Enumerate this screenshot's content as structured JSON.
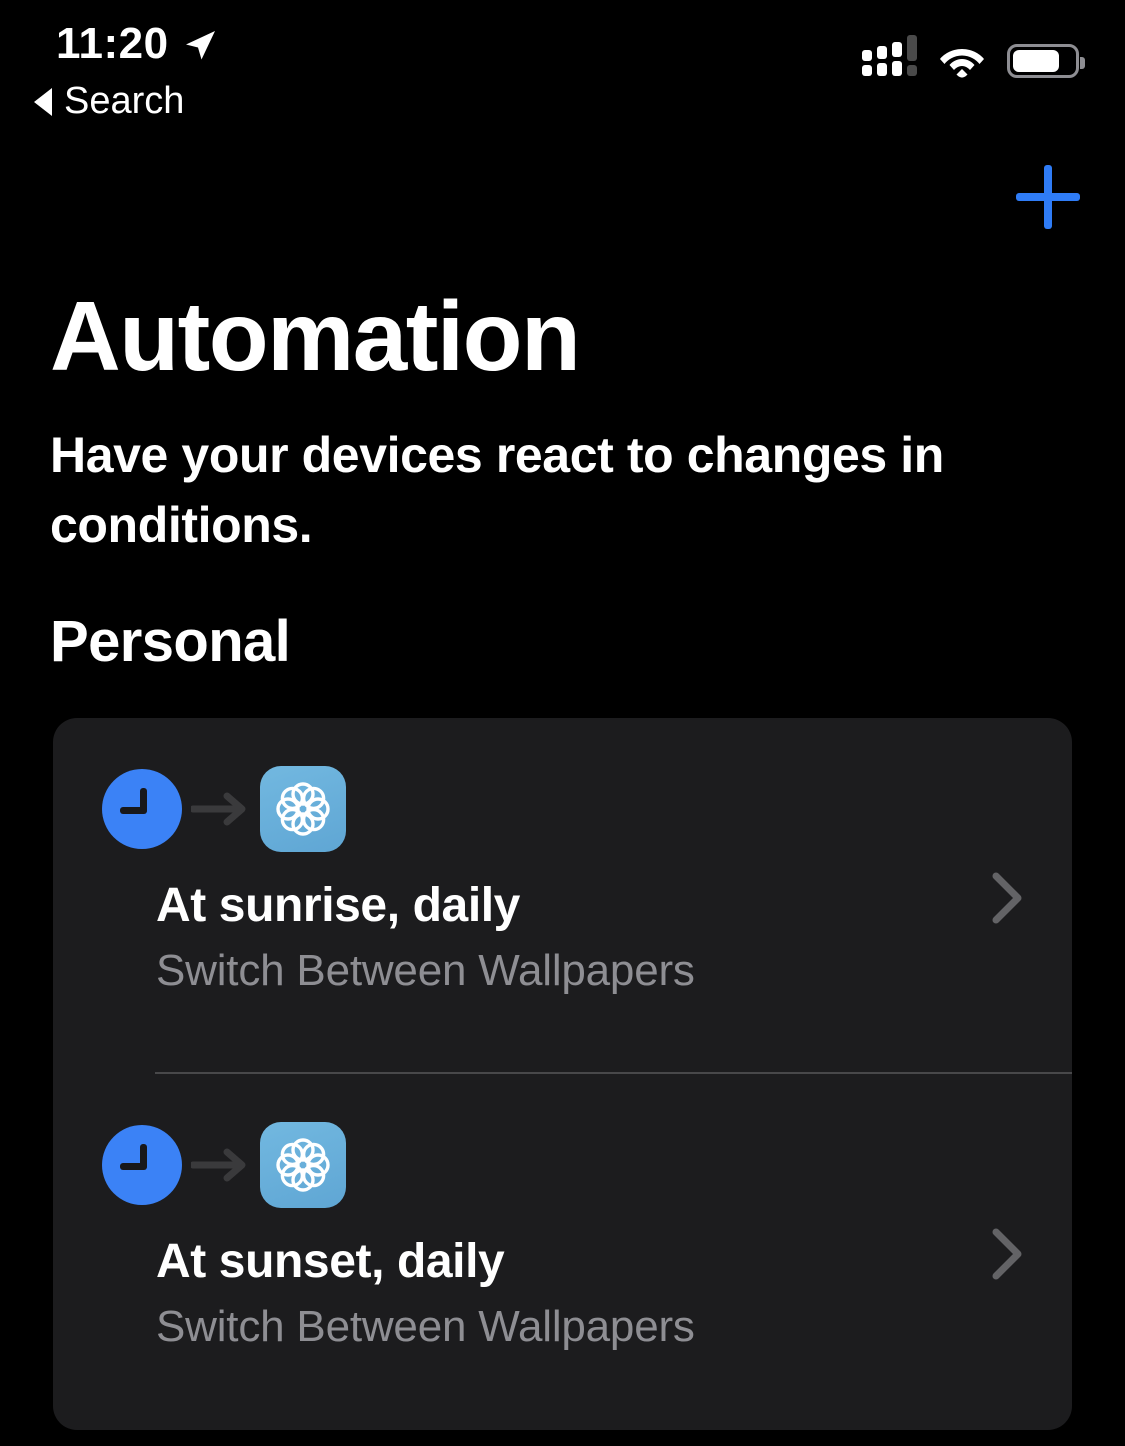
{
  "status_bar": {
    "time": "11:20",
    "location_icon": "location-arrow-icon",
    "signal_icon": "cellular-signal-icon",
    "wifi_icon": "wifi-icon",
    "battery_icon": "battery-icon",
    "battery_level_percent": 75
  },
  "navigation": {
    "back_label": "Search",
    "back_icon": "back-triangle-icon",
    "add_icon": "plus-icon"
  },
  "header": {
    "title": "Automation",
    "subtitle": "Have your devices react to changes in conditions."
  },
  "sections": [
    {
      "title": "Personal",
      "automations": [
        {
          "trigger_icon": "clock-icon",
          "arrow_icon": "arrow-right-icon",
          "action_icon": "shortcuts-app-icon",
          "title": "At sunrise, daily",
          "subtitle": "Switch Between Wallpapers",
          "chevron_icon": "chevron-right-icon"
        },
        {
          "trigger_icon": "clock-icon",
          "arrow_icon": "arrow-right-icon",
          "action_icon": "shortcuts-app-icon",
          "title": "At sunset, daily",
          "subtitle": "Switch Between Wallpapers",
          "chevron_icon": "chevron-right-icon"
        }
      ]
    }
  ],
  "colors": {
    "background": "#000000",
    "card_background": "#1C1C1E",
    "accent_blue": "#2F7CF6",
    "clock_blue": "#3B82F6",
    "shortcuts_blue": "#6BAFDC",
    "secondary_text": "#8E8E93",
    "divider": "#48484A"
  }
}
